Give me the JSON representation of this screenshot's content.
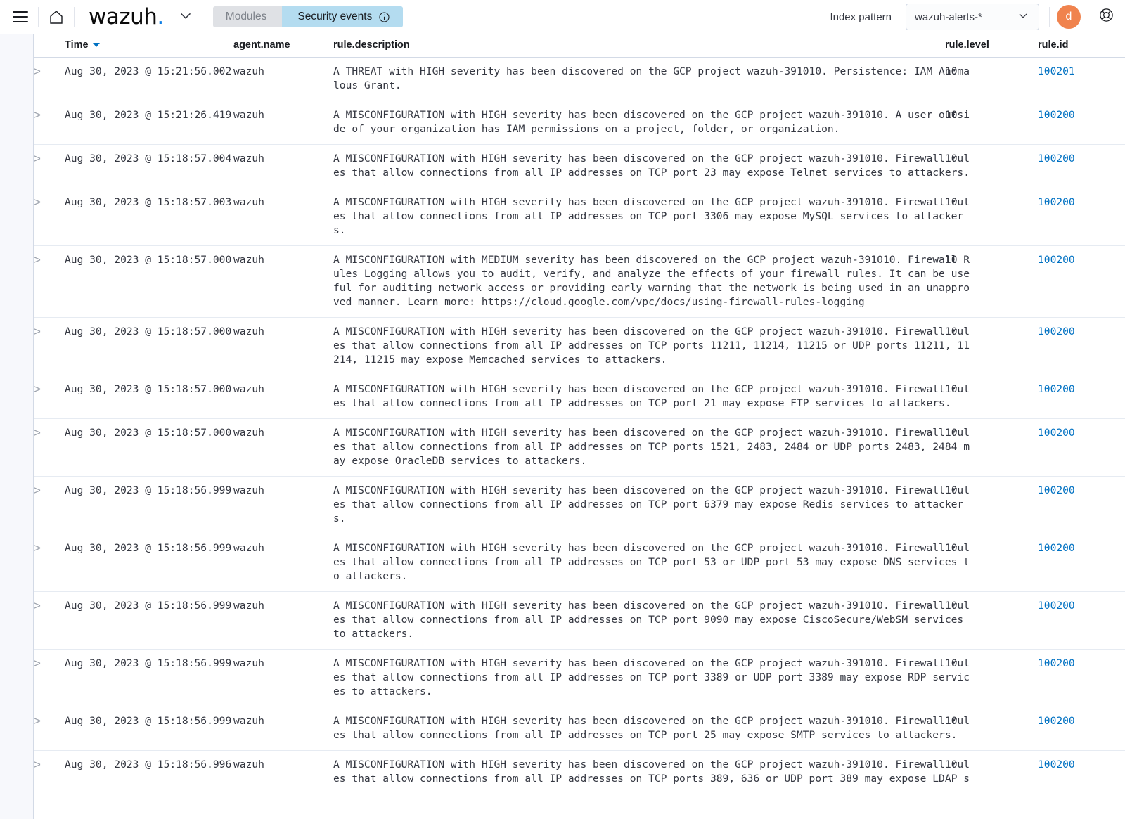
{
  "header": {
    "menu_icon": "hamburger-icon",
    "home_icon": "home-icon",
    "brand": "wazuh",
    "brand_dot": ".",
    "chevron_icon": "chevron-down-icon",
    "breadcrumbs": [
      {
        "label": "Modules",
        "active": false
      },
      {
        "label": "Security events",
        "active": true,
        "info_icon": "info-icon"
      }
    ],
    "index_pattern_label": "Index pattern",
    "index_pattern_value": "wazuh-alerts-*",
    "index_pattern_caret": "chevron-down-icon",
    "avatar_initial": "d",
    "help_icon": "lifebuoy-icon",
    "accent_blue": "#0e7ee4",
    "link_blue": "#0071c2",
    "avatar_color": "#f0834e",
    "active_crumb_color": "#b4dcf0",
    "inactive_crumb_color": "#dfe1e5"
  },
  "table": {
    "columns": [
      {
        "key": "toggle",
        "label": ""
      },
      {
        "key": "time",
        "label": "Time",
        "sorted": true
      },
      {
        "key": "agent",
        "label": "agent.name"
      },
      {
        "key": "desc",
        "label": "rule.description"
      },
      {
        "key": "level",
        "label": "rule.level"
      },
      {
        "key": "id",
        "label": "rule.id"
      }
    ],
    "rows": [
      {
        "toggle": ">",
        "time": "Aug 30, 2023 @ 15:21:56.002",
        "agent": "wazuh",
        "desc": "A THREAT with HIGH severity has been discovered on the GCP project wazuh-391010. Persistence: IAM Anoma\nlous Grant.",
        "level": "10",
        "id": "100201"
      },
      {
        "toggle": ">",
        "time": "Aug 30, 2023 @ 15:21:26.419",
        "agent": "wazuh",
        "desc": "A MISCONFIGURATION with HIGH severity has been discovered on the GCP project wazuh-391010. A user outsi\nde of your organization has IAM permissions on a project, folder, or organization.",
        "level": "10",
        "id": "100200"
      },
      {
        "toggle": ">",
        "time": "Aug 30, 2023 @ 15:18:57.004",
        "agent": "wazuh",
        "desc": "A MISCONFIGURATION with HIGH severity has been discovered on the GCP project wazuh-391010. Firewall rul\nes that allow connections from all IP addresses on TCP port 23 may expose Telnet services to attackers.",
        "level": "10",
        "id": "100200"
      },
      {
        "toggle": ">",
        "time": "Aug 30, 2023 @ 15:18:57.003",
        "agent": "wazuh",
        "desc": "A MISCONFIGURATION with HIGH severity has been discovered on the GCP project wazuh-391010. Firewall rul\nes that allow connections from all IP addresses on TCP port 3306 may expose MySQL services to attacker\ns.",
        "level": "10",
        "id": "100200"
      },
      {
        "toggle": ">",
        "time": "Aug 30, 2023 @ 15:18:57.000",
        "agent": "wazuh",
        "desc": "A MISCONFIGURATION with MEDIUM severity has been discovered on the GCP project wazuh-391010. Firewall R\nules Logging allows you to audit, verify, and analyze the effects of your firewall rules. It can be use\nful for auditing network access or providing early warning that the network is being used in an unappro\nved manner. Learn more: https://cloud.google.com/vpc/docs/using-firewall-rules-logging",
        "level": "10",
        "id": "100200"
      },
      {
        "toggle": ">",
        "time": "Aug 30, 2023 @ 15:18:57.000",
        "agent": "wazuh",
        "desc": "A MISCONFIGURATION with HIGH severity has been discovered on the GCP project wazuh-391010. Firewall rul\nes that allow connections from all IP addresses on TCP ports 11211, 11214, 11215 or UDP ports 11211, 11\n214, 11215 may expose Memcached services to attackers.",
        "level": "10",
        "id": "100200"
      },
      {
        "toggle": ">",
        "time": "Aug 30, 2023 @ 15:18:57.000",
        "agent": "wazuh",
        "desc": "A MISCONFIGURATION with HIGH severity has been discovered on the GCP project wazuh-391010. Firewall rul\nes that allow connections from all IP addresses on TCP port 21 may expose FTP services to attackers.",
        "level": "10",
        "id": "100200"
      },
      {
        "toggle": ">",
        "time": "Aug 30, 2023 @ 15:18:57.000",
        "agent": "wazuh",
        "desc": "A MISCONFIGURATION with HIGH severity has been discovered on the GCP project wazuh-391010. Firewall rul\nes that allow connections from all IP addresses on TCP ports 1521, 2483, 2484 or UDP ports 2483, 2484 m\nay expose OracleDB services to attackers.",
        "level": "10",
        "id": "100200"
      },
      {
        "toggle": ">",
        "time": "Aug 30, 2023 @ 15:18:56.999",
        "agent": "wazuh",
        "desc": "A MISCONFIGURATION with HIGH severity has been discovered on the GCP project wazuh-391010. Firewall rul\nes that allow connections from all IP addresses on TCP port 6379 may expose Redis services to attacker\ns.",
        "level": "10",
        "id": "100200"
      },
      {
        "toggle": ">",
        "time": "Aug 30, 2023 @ 15:18:56.999",
        "agent": "wazuh",
        "desc": "A MISCONFIGURATION with HIGH severity has been discovered on the GCP project wazuh-391010. Firewall rul\nes that allow connections from all IP addresses on TCP port 53 or UDP port 53 may expose DNS services t\no attackers.",
        "level": "10",
        "id": "100200"
      },
      {
        "toggle": ">",
        "time": "Aug 30, 2023 @ 15:18:56.999",
        "agent": "wazuh",
        "desc": "A MISCONFIGURATION with HIGH severity has been discovered on the GCP project wazuh-391010. Firewall rul\nes that allow connections from all IP addresses on TCP port 9090 may expose CiscoSecure/WebSM services\nto attackers.",
        "level": "10",
        "id": "100200"
      },
      {
        "toggle": ">",
        "time": "Aug 30, 2023 @ 15:18:56.999",
        "agent": "wazuh",
        "desc": "A MISCONFIGURATION with HIGH severity has been discovered on the GCP project wazuh-391010. Firewall rul\nes that allow connections from all IP addresses on TCP port 3389 or UDP port 3389 may expose RDP servic\nes to attackers.",
        "level": "10",
        "id": "100200"
      },
      {
        "toggle": ">",
        "time": "Aug 30, 2023 @ 15:18:56.999",
        "agent": "wazuh",
        "desc": "A MISCONFIGURATION with HIGH severity has been discovered on the GCP project wazuh-391010. Firewall rul\nes that allow connections from all IP addresses on TCP port 25 may expose SMTP services to attackers.",
        "level": "10",
        "id": "100200"
      },
      {
        "toggle": ">",
        "time": "Aug 30, 2023 @ 15:18:56.996",
        "agent": "wazuh",
        "desc": "A MISCONFIGURATION with HIGH severity has been discovered on the GCP project wazuh-391010. Firewall rul\nes that allow connections from all IP addresses on TCP ports 389, 636 or UDP port 389 may expose LDAP s",
        "level": "10",
        "id": "100200"
      }
    ]
  }
}
